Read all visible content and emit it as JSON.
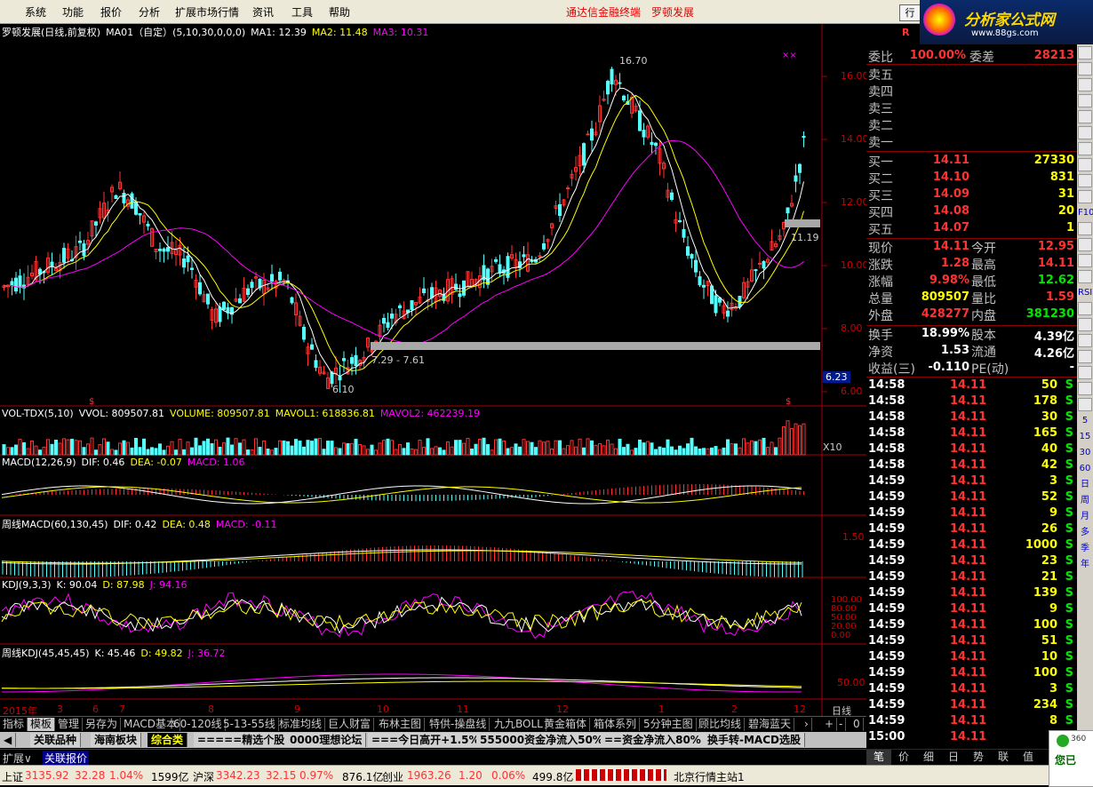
{
  "menu": {
    "items": [
      "系统",
      "功能",
      "报价",
      "分析",
      "扩展市场行情",
      "资讯",
      "工具",
      "帮助"
    ],
    "promo1": "通达信金融终端",
    "promo2": "罗顿发展",
    "btn": "行",
    "logo": "分析家公式网",
    "logo_url": "www.88gs.com"
  },
  "chart_header": {
    "name": "罗顿发展(日线,前复权)",
    "ma_name": "MA01（自定）(5,10,30,0,0,0)",
    "ma1": "MA1: 12.39",
    "ma2": "MA2: 11.48",
    "ma3": "MA3: 10.31"
  },
  "price_axis": [
    "16.00",
    "14.00",
    "12.00",
    "10.00",
    "8.00",
    "6.23",
    "6.00"
  ],
  "price_annotations": {
    "high": "16.70",
    "low": "6.10",
    "range": "7.29 - 7.61",
    "recent": "11.19"
  },
  "vol_header": {
    "name": "VOL-TDX(5,10)",
    "vvol": "VVOL: 809507.81",
    "volume": "VOLUME: 809507.81",
    "mavol1": "MAVOL1: 618836.81",
    "mavol2": "MAVOL2: 462239.19",
    "unit": "X10"
  },
  "macd_header": {
    "name": "MACD(12,26,9)",
    "dif": "DIF: 0.46",
    "dea": "DEA: -0.07",
    "macd": "MACD: 1.06"
  },
  "wmacd_header": {
    "name": "周线MACD(60,130,45)",
    "dif": "DIF: 0.42",
    "dea": "DEA: 0.48",
    "macd": "MACD: -0.11",
    "axis": "1.50"
  },
  "kdj_header": {
    "name": "KDJ(9,3,3)",
    "k": "K: 90.04",
    "d": "D: 87.98",
    "j": "J: 94.16",
    "axis": [
      "100.00",
      "80.00",
      "50.00",
      "20.00",
      "0.00"
    ]
  },
  "wkdj_header": {
    "name": "周线KDJ(45,45,45)",
    "k": "K: 45.46",
    "d": "D: 49.82",
    "j": "J: 36.72",
    "axis": "50.00"
  },
  "time_axis": {
    "labels": [
      "2015年",
      "3",
      "6",
      "7",
      "8",
      "9",
      "10",
      "11",
      "12",
      "1",
      "2",
      "12"
    ],
    "period": "日线"
  },
  "bottom_tabs": [
    "指标",
    "模板",
    "管理",
    "另存为",
    "MACD基本",
    "60-120线",
    "5-13-55线",
    "标准均线",
    "巨人财富",
    "布林主图",
    "特供-操盘线",
    "九九BOLL",
    "黄金箱体",
    "箱体系列",
    "5分钟主图",
    "顾比均线",
    "碧海蓝天"
  ],
  "section_tabs": [
    "关联品种",
    "海南板块",
    "综合类",
    "=====精选个股",
    "0000理想论坛",
    "===今日高开+1.5%",
    "555000资金净流入50%",
    "==资金净流入80%",
    "换手转-MACD选股"
  ],
  "ext": {
    "expand": "扩展∨",
    "related": "关联报价"
  },
  "quote": {
    "code_label": "R",
    "weibi_label": "委比",
    "weibi": "100.00%",
    "weicha_label": "委差",
    "weicha": "28213",
    "sell": [
      {
        "label": "卖五"
      },
      {
        "label": "卖四"
      },
      {
        "label": "卖三"
      },
      {
        "label": "卖二"
      },
      {
        "label": "卖一"
      }
    ],
    "buy": [
      {
        "label": "买一",
        "price": "14.11",
        "vol": "27330"
      },
      {
        "label": "买二",
        "price": "14.10",
        "vol": "831"
      },
      {
        "label": "买三",
        "price": "14.09",
        "vol": "31"
      },
      {
        "label": "买四",
        "price": "14.08",
        "vol": "20"
      },
      {
        "label": "买五",
        "price": "14.07",
        "vol": "1"
      }
    ],
    "stats": [
      {
        "l1": "现价",
        "v1": "14.11",
        "l2": "今开",
        "v2": "12.95"
      },
      {
        "l1": "涨跌",
        "v1": "1.28",
        "l2": "最高",
        "v2": "14.11"
      },
      {
        "l1": "涨幅",
        "v1": "9.98%",
        "l2": "最低",
        "v2": "12.62"
      },
      {
        "l1": "总量",
        "v1": "809507",
        "l2": "量比",
        "v2": "1.59"
      },
      {
        "l1": "外盘",
        "v1": "428277",
        "l2": "内盘",
        "v2": "381230"
      }
    ],
    "stats2": [
      {
        "l1": "换手",
        "v1": "18.99%",
        "l2": "股本",
        "v2": "4.39亿"
      },
      {
        "l1": "净资",
        "v1": "1.53",
        "l2": "流通",
        "v2": "4.26亿"
      },
      {
        "l1": "收益(三)",
        "v1": "-0.110",
        "l2": "PE(动)",
        "v2": "-"
      }
    ]
  },
  "ticks": [
    {
      "t": "14:58",
      "p": "14.11",
      "v": "50",
      "s": "S"
    },
    {
      "t": "14:58",
      "p": "14.11",
      "v": "178",
      "s": "S"
    },
    {
      "t": "14:58",
      "p": "14.11",
      "v": "30",
      "s": "S"
    },
    {
      "t": "14:58",
      "p": "14.11",
      "v": "165",
      "s": "S"
    },
    {
      "t": "14:58",
      "p": "14.11",
      "v": "40",
      "s": "S"
    },
    {
      "t": "14:58",
      "p": "14.11",
      "v": "42",
      "s": "S"
    },
    {
      "t": "14:59",
      "p": "14.11",
      "v": "3",
      "s": "S"
    },
    {
      "t": "14:59",
      "p": "14.11",
      "v": "52",
      "s": "S"
    },
    {
      "t": "14:59",
      "p": "14.11",
      "v": "9",
      "s": "S"
    },
    {
      "t": "14:59",
      "p": "14.11",
      "v": "26",
      "s": "S"
    },
    {
      "t": "14:59",
      "p": "14.11",
      "v": "1000",
      "s": "S"
    },
    {
      "t": "14:59",
      "p": "14.11",
      "v": "23",
      "s": "S"
    },
    {
      "t": "14:59",
      "p": "14.11",
      "v": "21",
      "s": "S"
    },
    {
      "t": "14:59",
      "p": "14.11",
      "v": "139",
      "s": "S"
    },
    {
      "t": "14:59",
      "p": "14.11",
      "v": "9",
      "s": "S"
    },
    {
      "t": "14:59",
      "p": "14.11",
      "v": "100",
      "s": "S"
    },
    {
      "t": "14:59",
      "p": "14.11",
      "v": "51",
      "s": "S"
    },
    {
      "t": "14:59",
      "p": "14.11",
      "v": "10",
      "s": "S"
    },
    {
      "t": "14:59",
      "p": "14.11",
      "v": "100",
      "s": "S"
    },
    {
      "t": "14:59",
      "p": "14.11",
      "v": "3",
      "s": "S"
    },
    {
      "t": "14:59",
      "p": "14.11",
      "v": "234",
      "s": "S"
    },
    {
      "t": "14:59",
      "p": "14.11",
      "v": "8",
      "s": "S"
    },
    {
      "t": "15:00",
      "p": "14.11",
      "v": "3",
      "s": "S"
    }
  ],
  "right_tabs": [
    "笔",
    "价",
    "细",
    "日",
    "势",
    "联",
    "值"
  ],
  "right_tools": [
    "",
    "",
    "",
    "",
    "",
    "",
    "",
    "",
    "",
    "",
    "F10",
    "",
    "",
    "",
    "",
    "RSI",
    "",
    "",
    "",
    "",
    "",
    "",
    "",
    "5",
    "15",
    "30",
    "60",
    "日",
    "周",
    "月",
    "多",
    "季",
    "年"
  ],
  "status": {
    "sh_label": "上证",
    "sh_val": "3135.92",
    "sh_chg": "32.28",
    "sh_pct": "1.04%",
    "sh_amt": "1599亿",
    "hs_label": "沪深",
    "hs_val": "3342.23",
    "hs_chg": "32.15",
    "hs_pct": "0.97%",
    "hs_amt": "876.1亿",
    "cy_label": "创业",
    "cy_val": "1963.26",
    "cy_chg": "1.20",
    "cy_pct": "0.06%",
    "cy_amt": "499.8亿",
    "server": "北京行情主站1",
    "toast": "您已",
    "toast2": "360"
  }
}
